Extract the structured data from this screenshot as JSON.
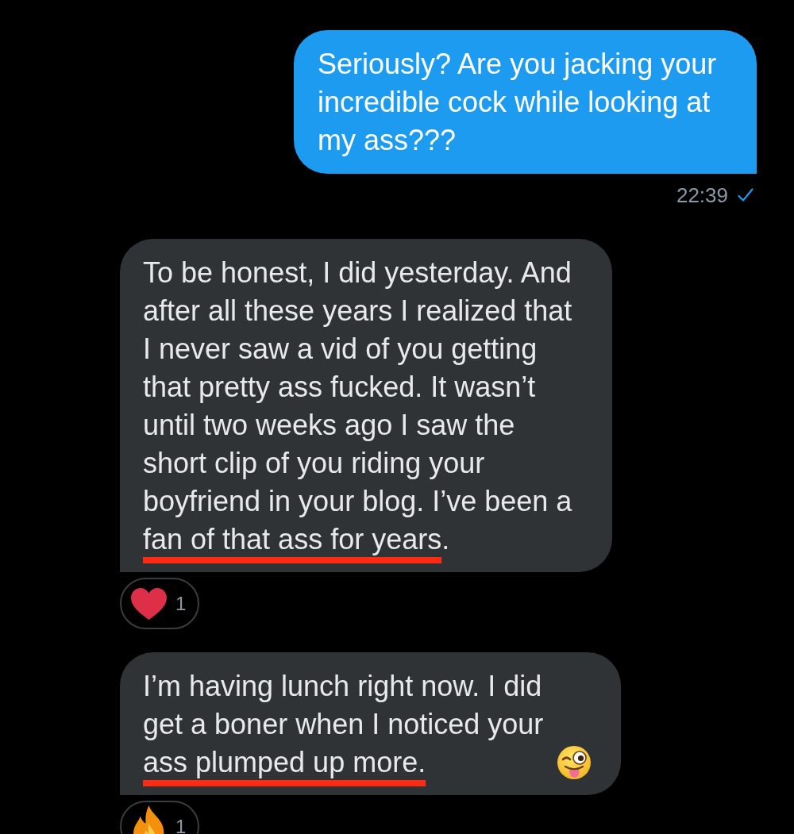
{
  "conversation": {
    "messages": [
      {
        "kind": "outgoing",
        "parts": [
          {
            "text": "Seriously? Are you jacking your incredible cock while looking at my ass???",
            "underlined": false
          }
        ],
        "time": "22:39",
        "seen": true
      },
      {
        "kind": "incoming",
        "parts": [
          {
            "text": "To be honest, I did yesterday. And after all these years I realized that I never saw a vid of you getting that pretty ass fucked. It wasn’t until two weeks ago I saw the short clip of you riding your boyfriend in your blog. I’ve been a ",
            "underlined": false
          },
          {
            "text": "fan of that ass for years",
            "underlined": true
          },
          {
            "text": ".",
            "underlined": false
          }
        ],
        "reactions": [
          {
            "kind": "heart",
            "count": "1"
          }
        ]
      },
      {
        "kind": "incoming",
        "parts": [
          {
            "text": "I’m having lunch right now. I did get a boner when I noticed your ",
            "underlined": false
          },
          {
            "text": "ass plumped up more.",
            "underlined": true
          }
        ],
        "emoji": {
          "kind": "wink"
        },
        "reactions": [
          {
            "kind": "fire",
            "count": "1"
          }
        ]
      }
    ]
  }
}
